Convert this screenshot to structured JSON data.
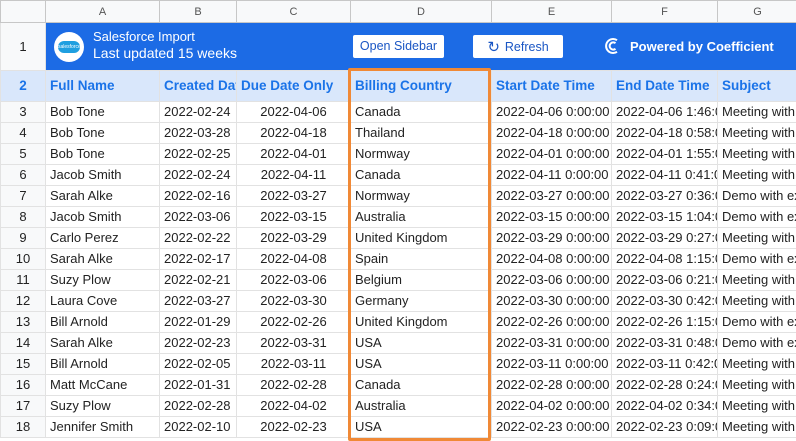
{
  "columns": [
    "A",
    "B",
    "C",
    "D",
    "E",
    "F",
    "G"
  ],
  "banner": {
    "title": "Salesforce Import",
    "subtitle": "Last updated 15 weeks",
    "logo_text": "salesforce",
    "open_sidebar_label": "Open Sidebar",
    "refresh_label": "Refresh",
    "powered_by": "Powered by Coefficient",
    "accent_color": "#1c6be5",
    "highlight_color": "#f08936"
  },
  "headers": [
    "Full Name",
    "Created Dat",
    "Due Date Only",
    "Billing Country",
    "Start Date Time",
    "End Date Time",
    "Subject"
  ],
  "rows": [
    {
      "num": "3",
      "cells": [
        "Bob Tone",
        "2022-02-24",
        "2022-04-06",
        "Canada",
        "2022-04-06 0:00:00",
        "2022-04-06 1:46:0",
        "Meeting with"
      ]
    },
    {
      "num": "4",
      "cells": [
        "Bob Tone",
        "2022-03-28",
        "2022-04-18",
        "Thailand",
        "2022-04-18 0:00:00",
        "2022-04-18 0:58:0",
        "Meeting with"
      ]
    },
    {
      "num": "5",
      "cells": [
        "Bob Tone",
        "2022-02-25",
        "2022-04-01",
        "Normway",
        "2022-04-01 0:00:00",
        "2022-04-01 1:55:0",
        "Meeting with"
      ]
    },
    {
      "num": "6",
      "cells": [
        "Jacob Smith",
        "2022-02-24",
        "2022-04-11",
        "Canada",
        "2022-04-11 0:00:00",
        "2022-04-11 0:41:0",
        "Meeting with"
      ]
    },
    {
      "num": "7",
      "cells": [
        "Sarah Alke",
        "2022-02-16",
        "2022-03-27",
        "Normway",
        "2022-03-27 0:00:00",
        "2022-03-27 0:36:0",
        "Demo with ex"
      ]
    },
    {
      "num": "8",
      "cells": [
        "Jacob Smith",
        "2022-03-06",
        "2022-03-15",
        "Australia",
        "2022-03-15 0:00:00",
        "2022-03-15 1:04:0",
        "Demo with ex"
      ]
    },
    {
      "num": "9",
      "cells": [
        "Carlo Perez",
        "2022-02-22",
        "2022-03-29",
        "United Kingdom",
        "2022-03-29 0:00:00",
        "2022-03-29 0:27:0",
        "Meeting with"
      ]
    },
    {
      "num": "10",
      "cells": [
        "Sarah Alke",
        "2022-02-17",
        "2022-04-08",
        "Spain",
        "2022-04-08 0:00:00",
        "2022-04-08 1:15:0",
        "Demo with ex"
      ]
    },
    {
      "num": "11",
      "cells": [
        "Suzy Plow",
        "2022-02-21",
        "2022-03-06",
        "Belgium",
        "2022-03-06 0:00:00",
        "2022-03-06 0:21:0",
        "Meeting with"
      ]
    },
    {
      "num": "12",
      "cells": [
        "Laura Cove",
        "2022-03-27",
        "2022-03-30",
        "Germany",
        "2022-03-30 0:00:00",
        "2022-03-30 0:42:0",
        "Meeting with"
      ]
    },
    {
      "num": "13",
      "cells": [
        "Bill Arnold",
        "2022-01-29",
        "2022-02-26",
        "United Kingdom",
        "2022-02-26 0:00:00",
        "2022-02-26 1:15:0",
        "Demo with ex"
      ]
    },
    {
      "num": "14",
      "cells": [
        "Sarah Alke",
        "2022-02-23",
        "2022-03-31",
        "USA",
        "2022-03-31 0:00:00",
        "2022-03-31 0:48:0",
        "Demo with ex"
      ]
    },
    {
      "num": "15",
      "cells": [
        "Bill Arnold",
        "2022-02-05",
        "2022-03-11",
        "USA",
        "2022-03-11 0:00:00",
        "2022-03-11 0:42:0",
        "Meeting with"
      ]
    },
    {
      "num": "16",
      "cells": [
        "Matt McCane",
        "2022-01-31",
        "2022-02-28",
        "Canada",
        "2022-02-28 0:00:00",
        "2022-02-28 0:24:0",
        "Meeting with"
      ]
    },
    {
      "num": "17",
      "cells": [
        "Suzy Plow",
        "2022-02-28",
        "2022-04-02",
        "Australia",
        "2022-04-02 0:00:00",
        "2022-04-02 0:34:0",
        "Meeting with"
      ]
    },
    {
      "num": "18",
      "cells": [
        "Jennifer Smith",
        "2022-02-10",
        "2022-02-23",
        "USA",
        "2022-02-23 0:00:00",
        "2022-02-23 0:09:0",
        "Meeting with"
      ]
    }
  ]
}
